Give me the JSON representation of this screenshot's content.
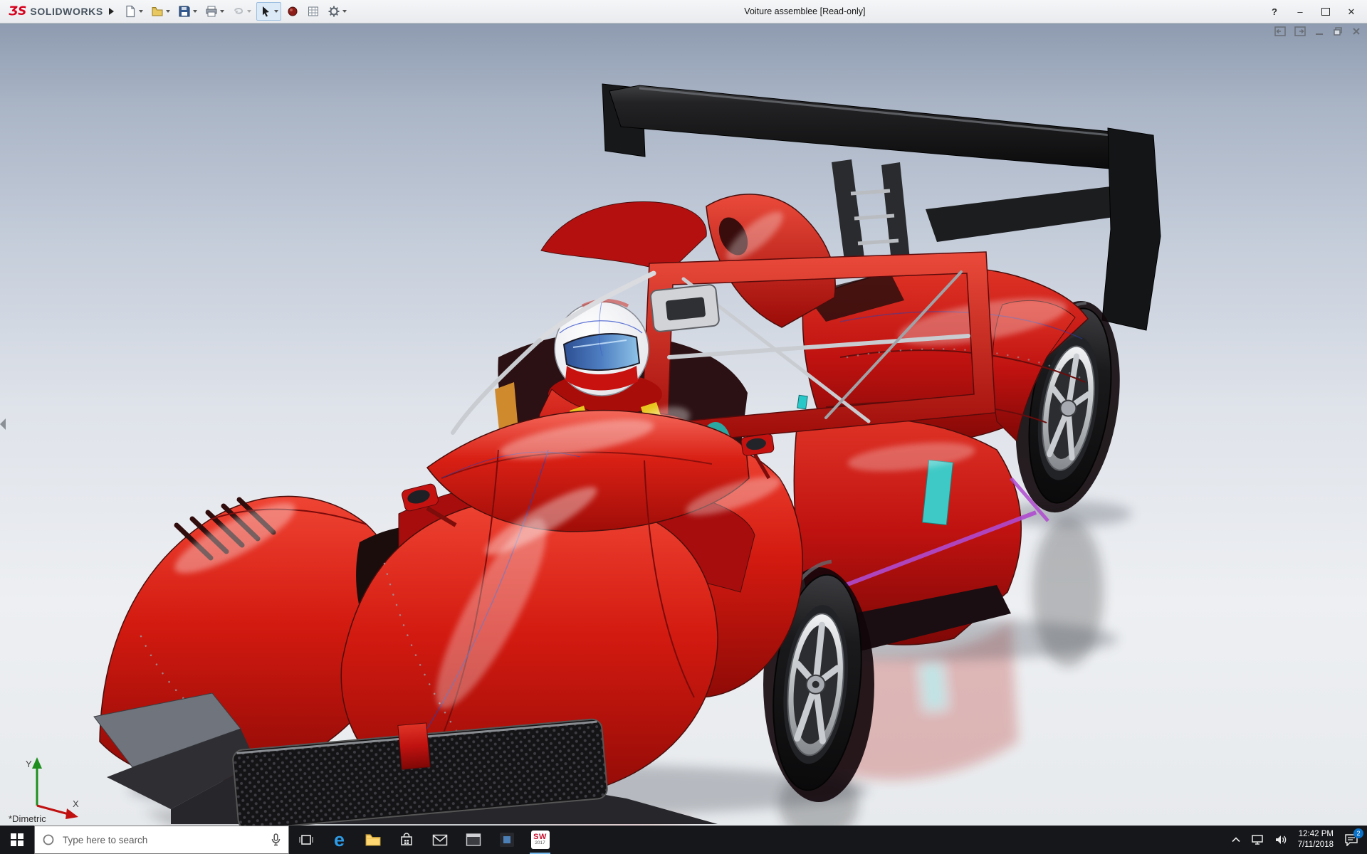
{
  "window": {
    "title": "Voiture assemblee [Read-only]",
    "brand": {
      "logo_glyph": "ƷS",
      "name": "SOLIDWORKS"
    },
    "controls": {
      "help": "?",
      "minimize": "–",
      "close": "✕"
    }
  },
  "toolbar": {
    "icons": [
      "new-document",
      "open",
      "save",
      "print",
      "undo",
      "select",
      "appearance",
      "design-table",
      "options"
    ]
  },
  "viewport": {
    "view_label": "*Dimetric",
    "triad": {
      "x_label": "X",
      "y_label": "Y"
    },
    "colors": {
      "car_red": "#d31a10",
      "wing_black": "#0b0b0c",
      "accent_cyan": "#3fc9c6",
      "accent_magenta": "#b04ad0",
      "background_top": "#8e9bb0",
      "background_bottom": "#e7eaed"
    }
  },
  "taskbar": {
    "search": {
      "placeholder": "Type here to search"
    },
    "edge_glyph": "e",
    "solidworks_icon": {
      "label": "SW",
      "year": "2017"
    },
    "clock": {
      "time": "12:42 PM",
      "date": "7/11/2018"
    },
    "notification_badge": "2"
  }
}
